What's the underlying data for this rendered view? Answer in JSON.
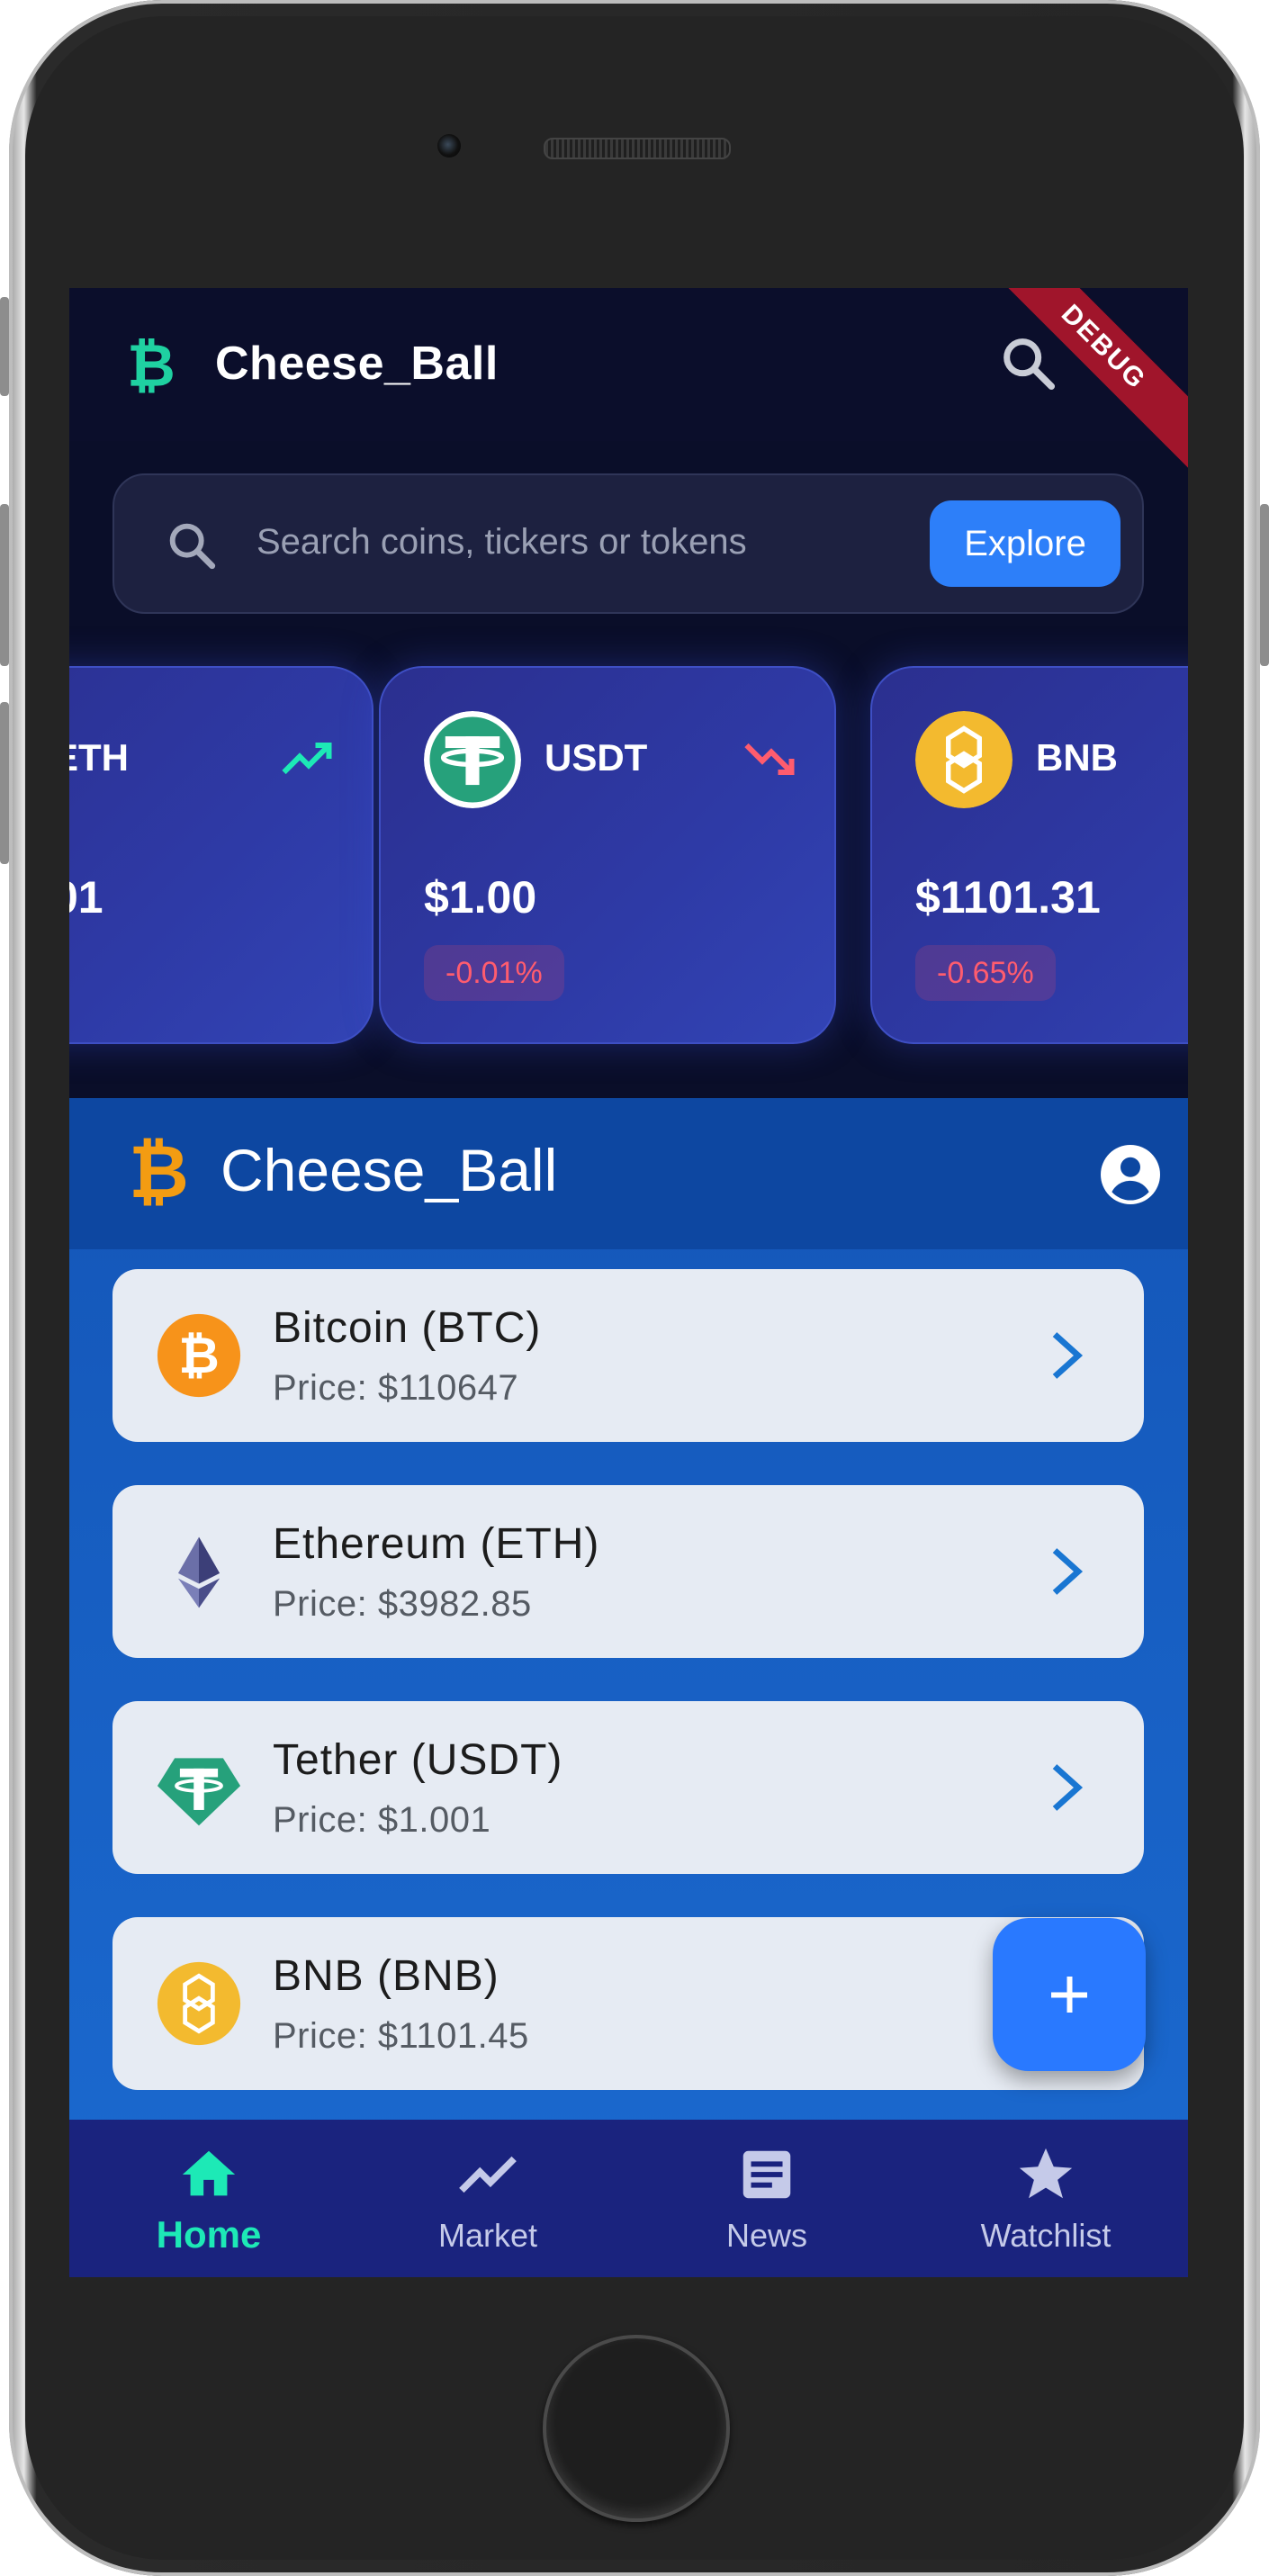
{
  "app": {
    "brand": "Cheese_Ball",
    "debug_banner": "DEBUG"
  },
  "search": {
    "placeholder": "Search coins, tickers or tokens",
    "explore_label": "Explore"
  },
  "top_cards": [
    {
      "symbol": "ETH",
      "price": "01",
      "trend": "up"
    },
    {
      "symbol": "USDT",
      "price": "$1.00",
      "change": "-0.01%",
      "trend": "down"
    },
    {
      "symbol": "BNB",
      "price": "$1101.31",
      "change": "-0.65%",
      "trend": "down"
    }
  ],
  "section": {
    "title": "Cheese_Ball"
  },
  "coins": [
    {
      "name": "Bitcoin (BTC)",
      "price": "Price: $110647",
      "icon": "bitcoin-icon"
    },
    {
      "name": "Ethereum (ETH)",
      "price": "Price: $3982.85",
      "icon": "ethereum-icon"
    },
    {
      "name": "Tether (USDT)",
      "price": "Price: $1.001",
      "icon": "tether-icon"
    },
    {
      "name": "BNB (BNB)",
      "price": "Price: $1101.45",
      "icon": "bnb-icon"
    }
  ],
  "nav": {
    "items": [
      {
        "label": "Home",
        "icon": "home-icon",
        "active": true
      },
      {
        "label": "Market",
        "icon": "trending-icon",
        "active": false
      },
      {
        "label": "News",
        "icon": "news-icon",
        "active": false
      },
      {
        "label": "Watchlist",
        "icon": "star-icon",
        "active": false
      }
    ]
  },
  "colors": {
    "accent_green": "#1de9b6",
    "accent_blue": "#2979ff",
    "negative_red": "#ff5c6e",
    "bitcoin_orange": "#f7931a",
    "bnb_yellow": "#f3ba2f",
    "tether_teal": "#26a17b"
  }
}
